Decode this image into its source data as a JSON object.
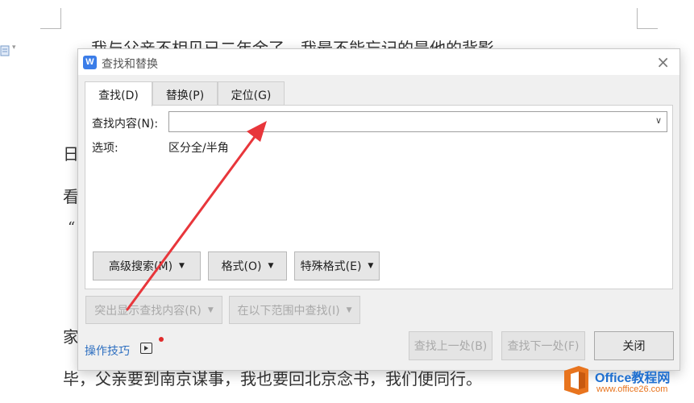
{
  "document": {
    "line_top": "我与父亲不相见已二年余了，我最不能忘记的是他的背影。",
    "side_chars": [
      "日",
      "看",
      "“",
      "家"
    ],
    "line_bottom": "毕，父亲要到南京谋事，我也要回北京念书，我们便同行。"
  },
  "dialog": {
    "title": "查找和替换",
    "close_glyph": "×",
    "app_logo": "W",
    "tabs": [
      {
        "label": "查找(D)",
        "active": true
      },
      {
        "label": "替换(P)",
        "active": false
      },
      {
        "label": "定位(G)",
        "active": false
      }
    ],
    "find": {
      "label": "查找内容(N):",
      "value": "",
      "placeholder": ""
    },
    "options": {
      "label": "选项:",
      "value": "区分全/半角"
    },
    "buttons": {
      "advanced_search": "高级搜索(M)",
      "format": "格式(O)",
      "special_format": "特殊格式(E)",
      "highlight_find": "突出显示查找内容(R)",
      "find_in_range": "在以下范围中查找(I)",
      "find_previous": "查找上一处(B)",
      "find_next": "查找下一处(F)",
      "close": "关闭"
    },
    "tips_link": "操作技巧"
  },
  "watermark": {
    "brand": "Office教程网",
    "site": "www.office26.com"
  },
  "colors": {
    "annotation_arrow": "#e8363b",
    "link": "#2e6fc0",
    "app_logo": "#3b7de8",
    "watermark_brand": "#1e6fd0",
    "watermark_accent": "#e8741e"
  }
}
